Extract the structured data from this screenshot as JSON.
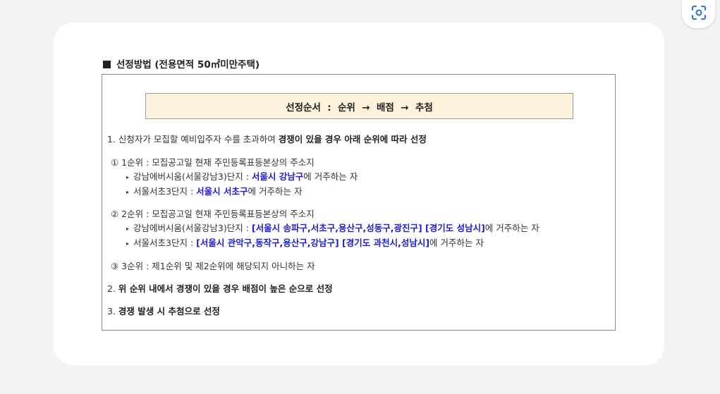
{
  "toolbar": {
    "lens_icon": "visual-search-icon"
  },
  "section": {
    "title": "선정방법 (전용면적 50㎡미만주택)"
  },
  "order_box": {
    "text": "선정순서  :  순위  →  배점  →  추첨"
  },
  "rule1": {
    "prefix": "1. 신청자가 모집할 예비입주자 수를 초과하여 ",
    "bold": "경쟁이 있을 경우 아래 순위에 따라 선정"
  },
  "rank1": {
    "title": "① 1순위 : 모집공고일 현재 주민등록표등본상의 주소지",
    "items": [
      {
        "prefix": "강남에버시움(서울강남3)단지 : ",
        "highlight": "서울시 강남구",
        "suffix": "에 거주하는 자"
      },
      {
        "prefix": "서울서초3단지 : ",
        "highlight": "서울시 서초구",
        "suffix": "에 거주하는 자"
      }
    ]
  },
  "rank2": {
    "title": "② 2순위 : 모집공고일 현재 주민등록표등본상의 주소지",
    "items": [
      {
        "prefix": "강남에버시움(서울강남3)단지 : ",
        "highlight": "[서울시 송파구,서초구,용산구,성동구,광진구] [경기도 성남시]",
        "suffix": "에 거주하는 자"
      },
      {
        "prefix": "서울서초3단지 : ",
        "highlight": "[서울시 관악구,동작구,용산구,강남구] [경기도 과천시,성남시]",
        "suffix": "에 거주하는 자"
      }
    ]
  },
  "rank3": {
    "title": "③ 3순위 : 제1순위 및 제2순위에 해당되지 아니하는 자"
  },
  "rule2": {
    "prefix": "2. ",
    "bold": "위 순위 내에서 경쟁이 있을 경우 배점이 높은 순으로 선정"
  },
  "rule3": {
    "prefix": "3. ",
    "bold": "경쟁 발생 시 추첨으로 선정"
  }
}
